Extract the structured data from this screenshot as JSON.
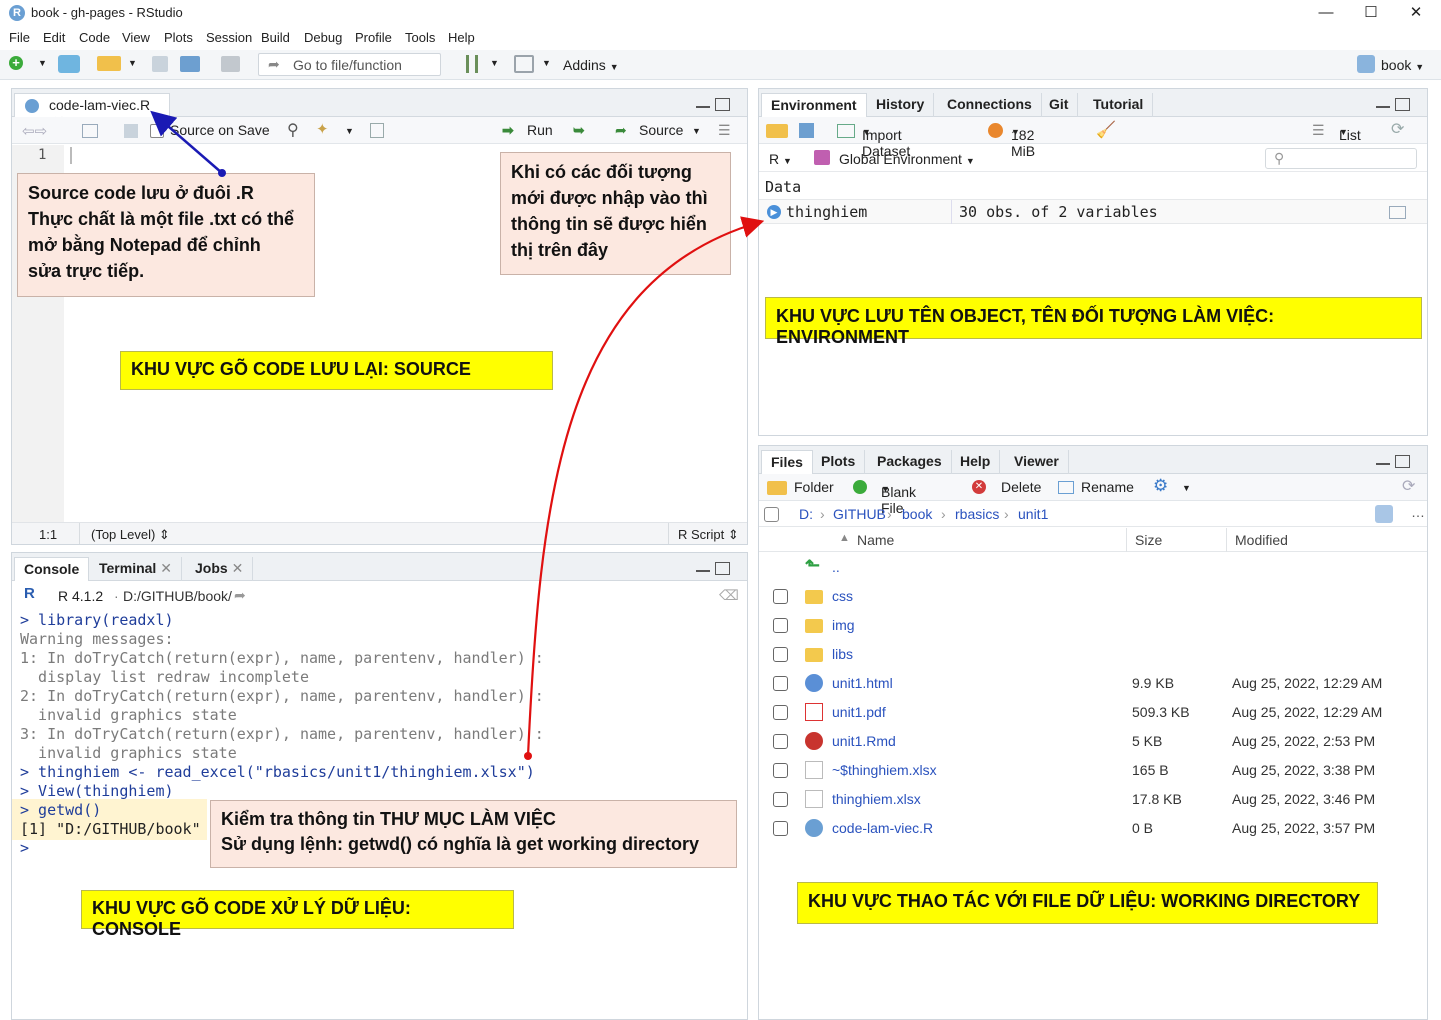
{
  "window": {
    "title": "book - gh-pages - RStudio",
    "minimize": "—",
    "maximize": "☐",
    "close": "✕"
  },
  "menu": [
    "File",
    "Edit",
    "Code",
    "View",
    "Plots",
    "Session",
    "Build",
    "Debug",
    "Profile",
    "Tools",
    "Help"
  ],
  "toolbar": {
    "goto_placeholder": "Go to file/function",
    "addins": "Addins",
    "project": "book"
  },
  "source": {
    "tab": "code-lam-viec.R",
    "source_on_save": "Source on Save",
    "run": "Run",
    "source_btn": "Source",
    "line_number": "1",
    "status_pos": "1:1",
    "status_level": "(Top Level)",
    "status_type": "R Script"
  },
  "console": {
    "tabs": [
      "Console",
      "Terminal",
      "Jobs"
    ],
    "r_version": "R 4.1.2",
    "path": "D:/GITHUB/book/",
    "lines": [
      {
        "text": "> library(readxl)",
        "cls": "blue"
      },
      {
        "text": "Warning messages:",
        "cls": "grey"
      },
      {
        "text": "1: In doTryCatch(return(expr), name, parentenv, handler) :",
        "cls": "grey"
      },
      {
        "text": "  display list redraw incomplete",
        "cls": "grey"
      },
      {
        "text": "2: In doTryCatch(return(expr), name, parentenv, handler) :",
        "cls": "grey"
      },
      {
        "text": "  invalid graphics state",
        "cls": "grey"
      },
      {
        "text": "3: In doTryCatch(return(expr), name, parentenv, handler) :",
        "cls": "grey"
      },
      {
        "text": "  invalid graphics state",
        "cls": "grey"
      },
      {
        "text": "> thinghiem <- read_excel(\"rbasics/unit1/thinghiem.xlsx\")",
        "cls": "blue"
      },
      {
        "text": "> View(thinghiem)",
        "cls": "blue"
      },
      {
        "text": "> getwd()",
        "cls": "blue"
      },
      {
        "text": "[1] \"D:/GITHUB/book\"",
        "cls": ""
      },
      {
        "text": ">",
        "cls": "blue"
      }
    ]
  },
  "environment": {
    "tabs": [
      "Environment",
      "History",
      "Connections",
      "Git",
      "Tutorial"
    ],
    "import_dataset": "Import Dataset",
    "memory": "182 MiB",
    "view_mode": "List",
    "lang": "R",
    "scope": "Global Environment",
    "section": "Data",
    "rows": [
      {
        "name": "thinghiem",
        "value": "30 obs. of 2 variables"
      }
    ]
  },
  "files": {
    "tabs": [
      "Files",
      "Plots",
      "Packages",
      "Help",
      "Viewer"
    ],
    "actions": [
      "Folder",
      "Blank File",
      "Delete",
      "Rename"
    ],
    "breadcrumb": [
      "D:",
      "GITHUB",
      "book",
      "rbasics",
      "unit1"
    ],
    "columns": [
      "Name",
      "Size",
      "Modified"
    ],
    "up": "..",
    "rows": [
      {
        "name": "css",
        "size": "",
        "modified": "",
        "icon": "folder"
      },
      {
        "name": "img",
        "size": "",
        "modified": "",
        "icon": "folder"
      },
      {
        "name": "libs",
        "size": "",
        "modified": "",
        "icon": "folder"
      },
      {
        "name": "unit1.html",
        "size": "9.9 KB",
        "modified": "Aug 25, 2022, 12:29 AM",
        "icon": "html"
      },
      {
        "name": "unit1.pdf",
        "size": "509.3 KB",
        "modified": "Aug 25, 2022, 12:29 AM",
        "icon": "pdf"
      },
      {
        "name": "unit1.Rmd",
        "size": "5 KB",
        "modified": "Aug 25, 2022, 2:53 PM",
        "icon": "rmd"
      },
      {
        "name": "~$thinghiem.xlsx",
        "size": "165 B",
        "modified": "Aug 25, 2022, 3:38 PM",
        "icon": "file"
      },
      {
        "name": "thinghiem.xlsx",
        "size": "17.8 KB",
        "modified": "Aug 25, 2022, 3:46 PM",
        "icon": "file"
      },
      {
        "name": "code-lam-viec.R",
        "size": "0 B",
        "modified": "Aug 25, 2022, 3:57 PM",
        "icon": "r"
      }
    ]
  },
  "annotations": {
    "source_note": [
      "Source code lưu ở đuôi .R",
      "Thực chất là một file .txt có thể",
      "mở bằng Notepad để chỉnh",
      "sửa trực tiếp."
    ],
    "env_note": [
      "Khi có các đối tượng",
      "mới được nhập vào thì",
      "thông tin sẽ được hiển",
      "thị trên đây"
    ],
    "console_note": [
      "Kiểm tra thông tin THƯ MỤC LÀM VIỆC",
      "Sử dụng lệnh: getwd() có nghĩa là get working directory"
    ],
    "label_source": "KHU VỰC GÕ CODE LƯU LẠI: SOURCE",
    "label_env": "KHU VỰC LƯU TÊN OBJECT, TÊN ĐỐI TƯỢNG LÀM VIỆC: ENVIRONMENT",
    "label_console": "KHU VỰC GÕ CODE XỬ LÝ DỮ LIỆU: CONSOLE",
    "label_files": "KHU VỰC THAO TÁC VỚI FILE DỮ LIỆU: WORKING DIRECTORY"
  }
}
